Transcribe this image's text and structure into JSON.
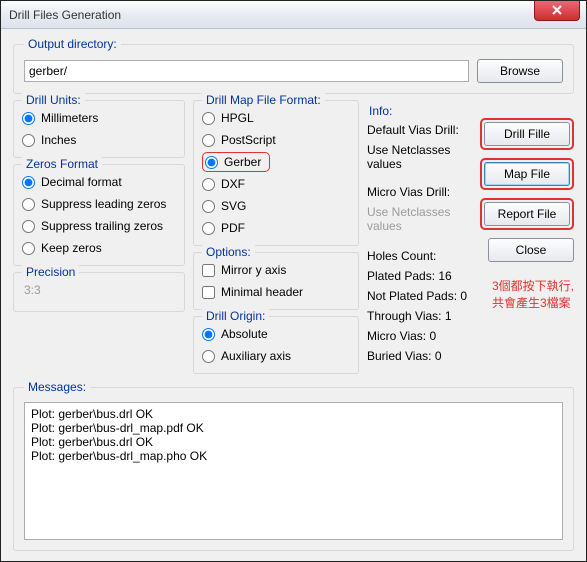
{
  "window": {
    "title": "Drill Files Generation"
  },
  "output": {
    "legend": "Output directory:",
    "value": "gerber/",
    "browse": "Browse"
  },
  "drillUnits": {
    "legend": "Drill Units:",
    "options": [
      "Millimeters",
      "Inches"
    ],
    "selected": "Millimeters"
  },
  "zerosFormat": {
    "legend": "Zeros Format",
    "options": [
      "Decimal format",
      "Suppress leading zeros",
      "Suppress trailing zeros",
      "Keep zeros"
    ],
    "selected": "Decimal format"
  },
  "precision": {
    "label": "Precision",
    "value": "3:3"
  },
  "mapFormat": {
    "legend": "Drill Map File Format:",
    "options": [
      "HPGL",
      "PostScript",
      "Gerber",
      "DXF",
      "SVG",
      "PDF"
    ],
    "selected": "Gerber"
  },
  "options": {
    "legend": "Options:",
    "mirror": "Mirror y axis",
    "minimal": "Minimal header"
  },
  "drillOrigin": {
    "legend": "Drill Origin:",
    "options": [
      "Absolute",
      "Auxiliary axis"
    ],
    "selected": "Absolute"
  },
  "info": {
    "legend": "Info:",
    "defaultVias": "Default Vias Drill:",
    "defaultViasVal": "Use Netclasses values",
    "microVias": "Micro Vias Drill:",
    "microViasVal": "Use Netclasses values",
    "holesCount": "Holes Count:",
    "platedPads": "Plated Pads: 16",
    "notPlatedPads": "Not Plated Pads: 0",
    "throughVias": "Through Vias: 1",
    "microViasCount": "Micro Vias: 0",
    "buriedVias": "Buried Vias: 0"
  },
  "buttons": {
    "drillFile": "Drill Fille",
    "mapFile": "Map File",
    "reportFile": "Report File",
    "close": "Close"
  },
  "annotation": {
    "line1": "3個都按下執行,",
    "line2": "共會產生3檔案"
  },
  "messages": {
    "legend": "Messages:",
    "text": "Plot: gerber\\bus.drl OK\nPlot: gerber\\bus-drl_map.pdf OK\nPlot: gerber\\bus.drl OK\nPlot: gerber\\bus-drl_map.pho OK"
  }
}
